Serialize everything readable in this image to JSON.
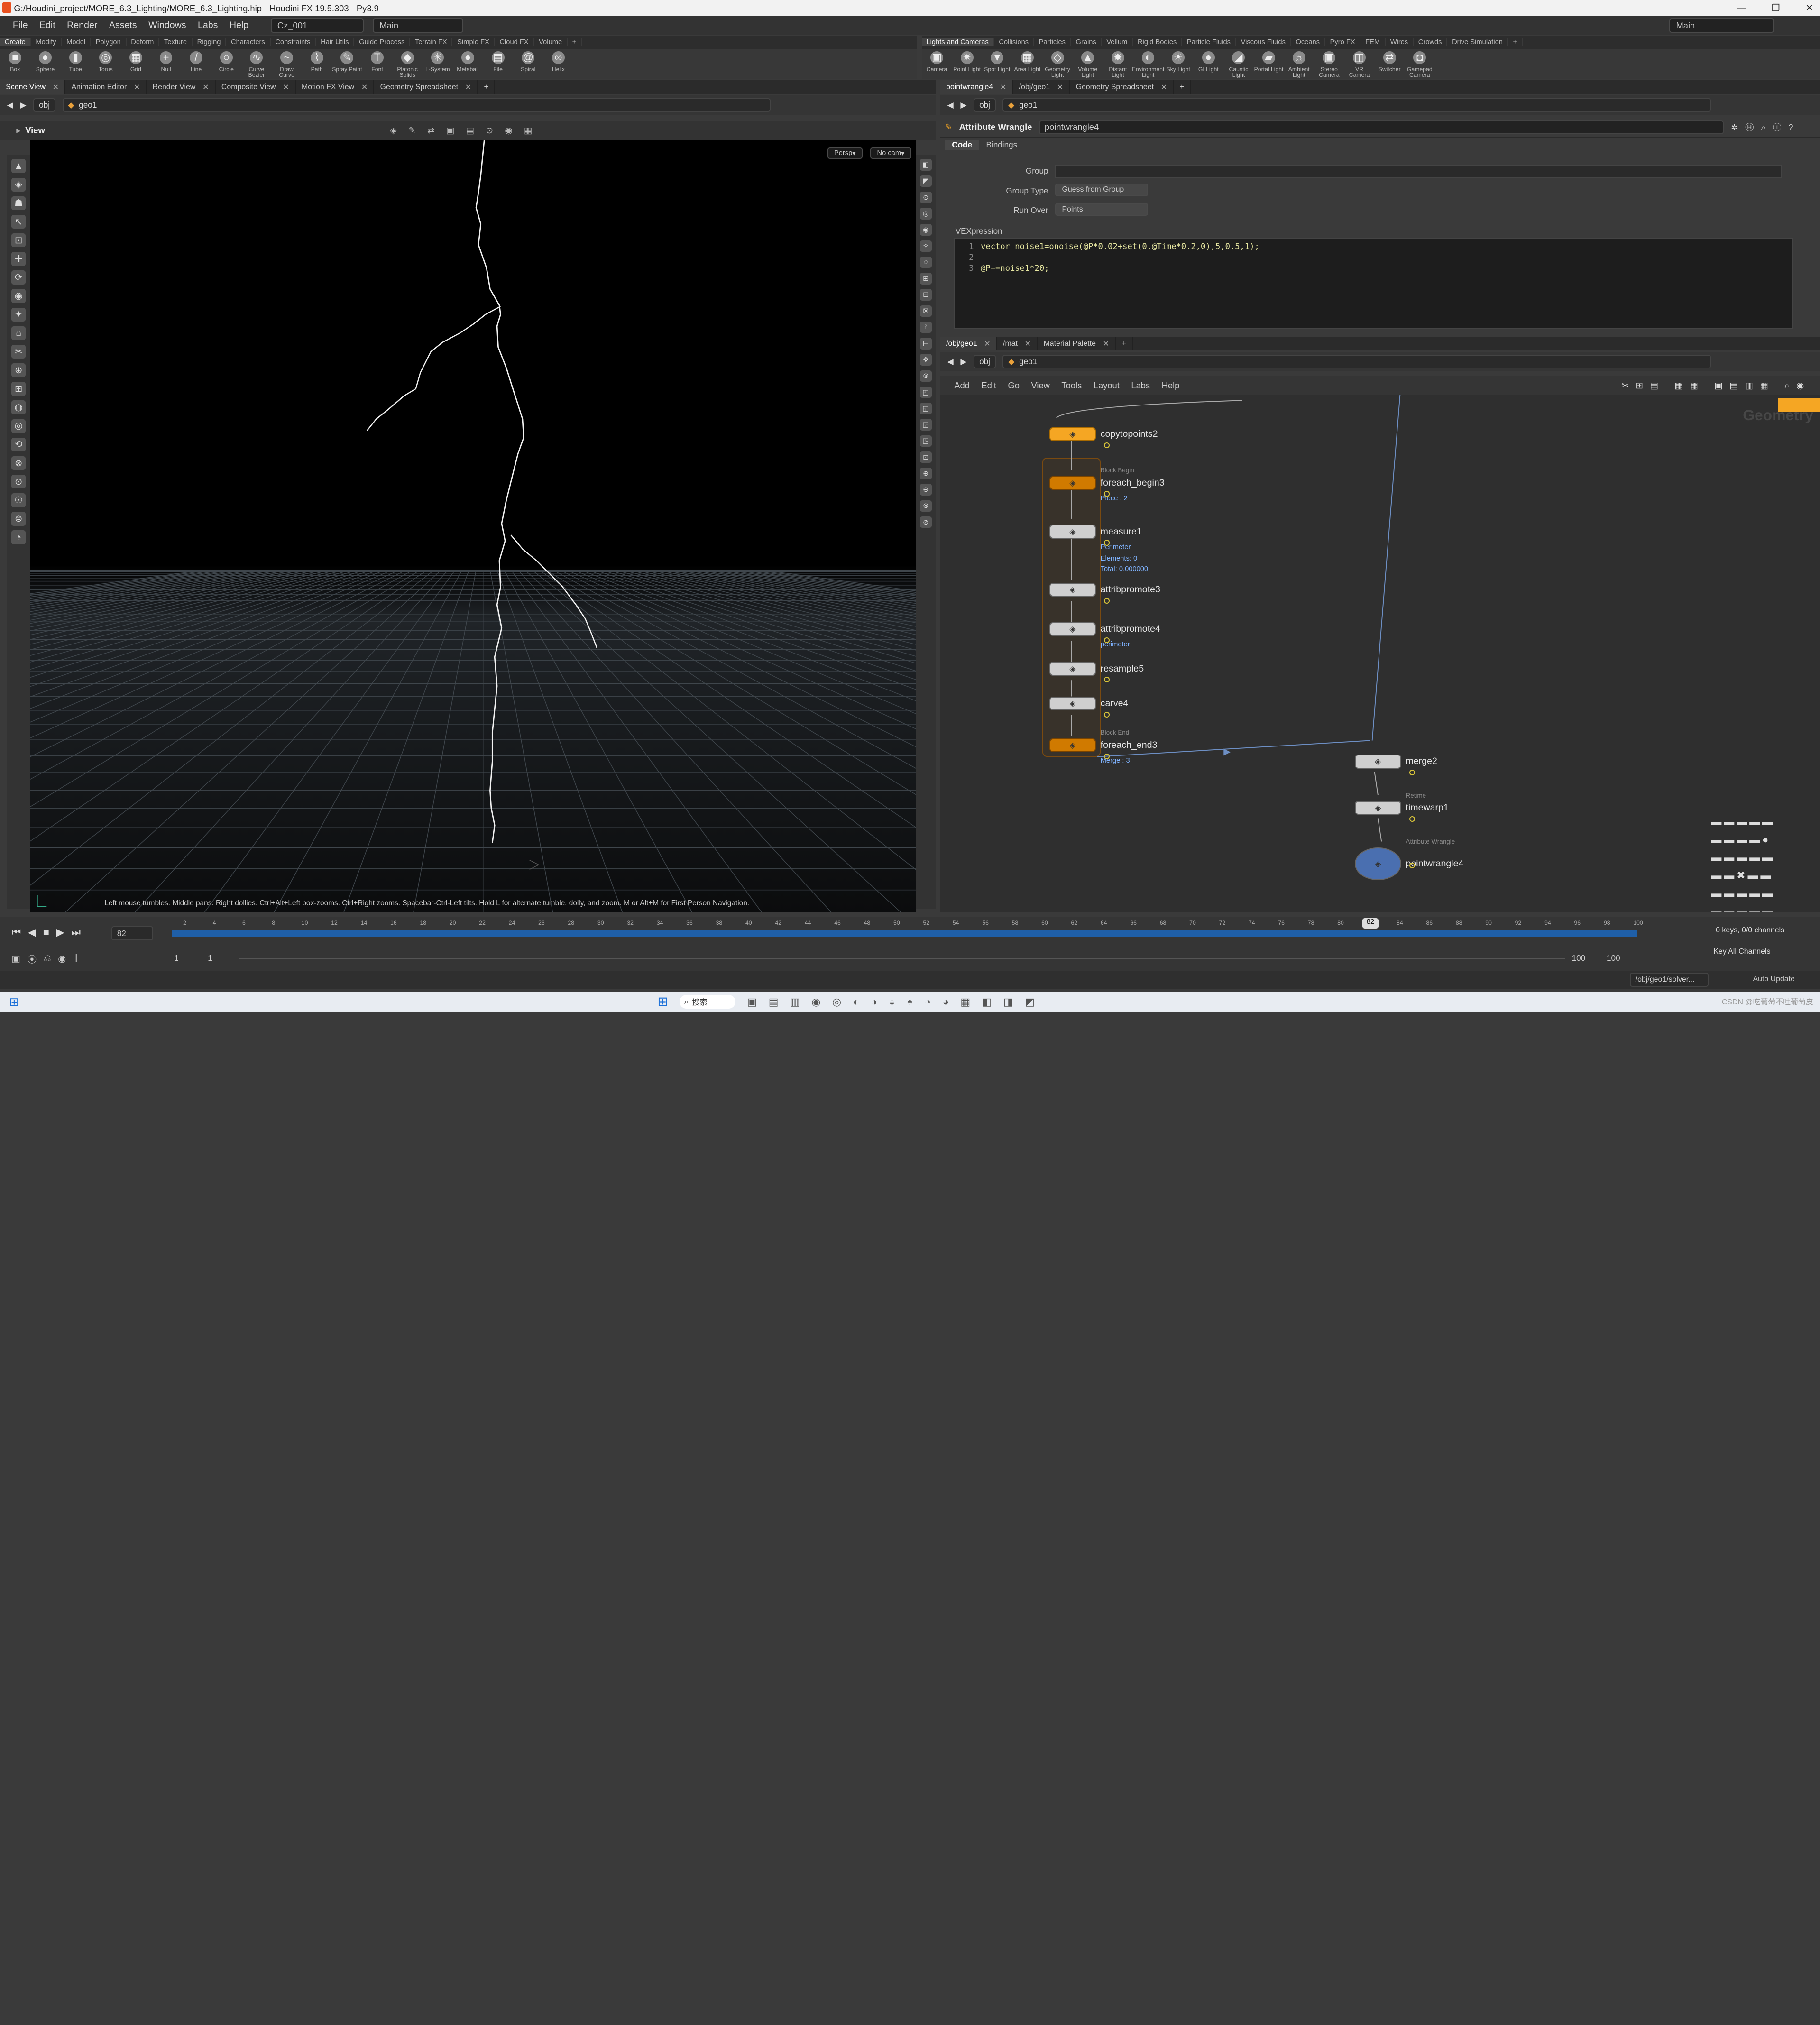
{
  "window": {
    "title": "G:/Houdini_project/MORE_6.3_Lighting/MORE_6.3_Lighting.hip - Houdini FX 19.5.303 - Py3.9"
  },
  "menubar": {
    "items": [
      "File",
      "Edit",
      "Render",
      "Assets",
      "Windows",
      "Labs",
      "Help"
    ],
    "desktop": "Cz_001",
    "context": "Main",
    "right_context": "Main"
  },
  "shelf_left": {
    "tabs": [
      "Create",
      "Modify",
      "Model",
      "Polygon",
      "Deform",
      "Texture",
      "Rigging",
      "Characters",
      "Constraints",
      "Hair Utils",
      "Guide Process",
      "Terrain FX",
      "Simple FX",
      "Cloud FX",
      "Volume"
    ],
    "tools": [
      "Box",
      "Sphere",
      "Tube",
      "Torus",
      "Grid",
      "Null",
      "Line",
      "Circle",
      "Curve Bezier",
      "Draw Curve",
      "Path",
      "Spray Paint",
      "Font",
      "Platonic Solids",
      "L-System",
      "Metaball",
      "File",
      "Spiral",
      "Helix"
    ]
  },
  "shelf_right": {
    "tabs": [
      "Lights and Cameras",
      "Collisions",
      "Particles",
      "Grains",
      "Vellum",
      "Rigid Bodies",
      "Particle Fluids",
      "Viscous Fluids",
      "Oceans",
      "Pyro FX",
      "FEM",
      "Wires",
      "Crowds",
      "Drive Simulation"
    ],
    "tools": [
      "Camera",
      "Point Light",
      "Spot Light",
      "Area Light",
      "Geometry Light",
      "Volume Light",
      "Distant Light",
      "Environment Light",
      "Sky Light",
      "GI Light",
      "Caustic Light",
      "Portal Light",
      "Ambient Light",
      "Stereo Camera",
      "VR Camera",
      "Switcher",
      "Gamepad Camera"
    ]
  },
  "left_panel": {
    "tabs": [
      "Scene View",
      "Animation Editor",
      "Render View",
      "Composite View",
      "Motion FX View",
      "Geometry Spreadsheet"
    ],
    "path": [
      "obj",
      "geo1"
    ],
    "view_label": "View",
    "persp": "Persp",
    "cam": "No cam",
    "hint": "Left mouse tumbles. Middle pans. Right dollies. Ctrl+Alt+Left box-zooms. Ctrl+Right zooms. Spacebar-Ctrl-Left tilts. Hold L for alternate tumble, dolly, and zoom.    M or Alt+M for First Person Navigation."
  },
  "param_panel": {
    "tabs": [
      "pointwrangle4",
      "/obj/geo1",
      "Geometry Spreadsheet"
    ],
    "path": [
      "obj",
      "geo1"
    ],
    "node_type": "Attribute Wrangle",
    "node_name": "pointwrangle4",
    "subtabs": [
      "Code",
      "Bindings"
    ],
    "group_label": "Group",
    "group_type_label": "Group Type",
    "group_type_value": "Guess from Group",
    "run_over_label": "Run Over",
    "run_over_value": "Points",
    "vex_label": "VEXpression",
    "code_lines": [
      {
        "n": "1",
        "text": "vector noise1=onoise(@P*0.02+set(0,@Time*0.2,0),5,0.5,1);"
      },
      {
        "n": "2",
        "text": ""
      },
      {
        "n": "3",
        "text": "@P+=noise1*20;"
      }
    ]
  },
  "network": {
    "tabs": [
      "/obj/geo1",
      "/mat",
      "Material Palette"
    ],
    "path": [
      "obj",
      "geo1"
    ],
    "menu": [
      "Add",
      "Edit",
      "Go",
      "View",
      "Tools",
      "Layout",
      "Labs",
      "Help"
    ],
    "watermark": "Geometry",
    "nodes": [
      {
        "name": "copytopoints2",
        "sup": "",
        "sub": ""
      },
      {
        "name": "foreach_begin3",
        "sup": "Block Begin",
        "sub": "Piece : 2"
      },
      {
        "name": "measure1",
        "sup": "",
        "sub": "Perimeter"
      },
      {
        "name": "attribpromote3",
        "sup": "",
        "sub": ""
      },
      {
        "name": "attribpromote4",
        "sup": "",
        "sub": "perimeter"
      },
      {
        "name": "resample5",
        "sup": "",
        "sub": ""
      },
      {
        "name": "carve4",
        "sup": "",
        "sub": ""
      },
      {
        "name": "foreach_end3",
        "sup": "Block End",
        "sub": "Merge : 3"
      },
      {
        "name": "merge2",
        "sup": "",
        "sub": ""
      },
      {
        "name": "timewarp1",
        "sup": "Retime",
        "sub": ""
      },
      {
        "name": "pointwrangle4",
        "sup": "Attribute Wrangle",
        "sub": ""
      }
    ],
    "measure_extra": [
      "Elements: 0",
      "Total: 0.000000"
    ]
  },
  "timeline": {
    "current_frame": "82",
    "start": "1",
    "start2": "1",
    "end": "100",
    "end2": "100",
    "keys_label": "0 keys, 0/0 channels",
    "key_all": "Key All Channels",
    "status_path": "/obj/geo1/solver...",
    "auto_update": "Auto Update",
    "ticks": [
      "2",
      "4",
      "6",
      "8",
      "10",
      "12",
      "14",
      "16",
      "18",
      "20",
      "22",
      "24",
      "26",
      "28",
      "30",
      "32",
      "34",
      "36",
      "38",
      "40",
      "42",
      "44",
      "46",
      "48",
      "50",
      "52",
      "54",
      "56",
      "58",
      "60",
      "62",
      "64",
      "66",
      "68",
      "70",
      "72",
      "74",
      "76",
      "78",
      "80",
      "82",
      "84",
      "86",
      "88",
      "90",
      "92",
      "94",
      "96",
      "98",
      "100"
    ]
  },
  "taskbar": {
    "search": "搜索",
    "watermark": "CSDN @吃葡萄不吐葡萄皮"
  },
  "colors": {
    "accent": "#f5a623",
    "timeline": "#1f5fa8",
    "viewport_bg": "#000000"
  }
}
